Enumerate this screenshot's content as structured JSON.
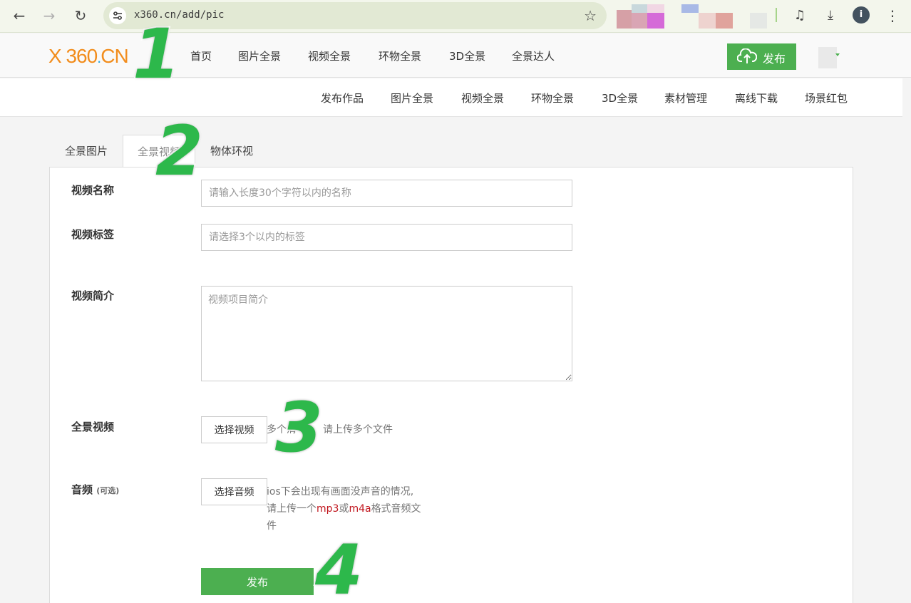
{
  "browser": {
    "url": "x360.cn/add/pic",
    "avatar_letter": "i"
  },
  "site": {
    "logo_text": "X 360",
    "logo_dot": ".",
    "logo_suffix": "CN",
    "main_nav": [
      "首页",
      "图片全景",
      "视频全景",
      "环物全景",
      "3D全景",
      "全景达人"
    ],
    "publish_label": "发布"
  },
  "sub_nav": [
    "发布作品",
    "图片全景",
    "视频全景",
    "环物全景",
    "3D全景",
    "素材管理",
    "离线下载",
    "场景红包"
  ],
  "tabs": [
    "全景图片",
    "全景视频",
    "物体环视"
  ],
  "form": {
    "name_label": "视频名称",
    "name_placeholder": "请输入长度30个字符以内的名称",
    "tags_label": "视频标签",
    "tags_placeholder": "请选择3个以内的标签",
    "intro_label": "视频简介",
    "intro_placeholder": "视频项目简介",
    "video_label": "全景视频",
    "video_button": "选择视频",
    "video_hint_a": "多个清",
    "video_hint_b": "请上传多个文件",
    "audio_label": "音频",
    "audio_optional": "(可选)",
    "audio_button": "选择音频",
    "audio_hint_1": "ios下会出现有画面没声音的情况,",
    "audio_hint_2a": "请上传一个",
    "audio_hint_mp3": "mp3",
    "audio_hint_or": "或",
    "audio_hint_m4a": "m4a",
    "audio_hint_2b": "格式音频文",
    "audio_hint_3": "件",
    "submit_label": "发布"
  },
  "steps": [
    "1",
    "2",
    "3",
    "4"
  ],
  "colors": {
    "accent_green": "#4caf50",
    "step_green": "#2db84b",
    "logo_orange": "#f28d1d",
    "hint_red": "#c0141c"
  }
}
